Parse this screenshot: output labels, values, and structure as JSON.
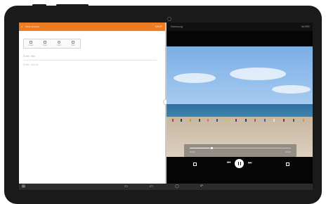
{
  "left_app": {
    "title": "New memo",
    "action": "SAVE",
    "toolbar": [
      {
        "label": "Image",
        "icon": "image-icon"
      },
      {
        "label": "Draw",
        "icon": "draw-icon"
      },
      {
        "label": "Voice",
        "icon": "microphone-icon"
      },
      {
        "label": "Task",
        "icon": "checkbox-icon"
      }
    ],
    "title_placeholder": "Enter title",
    "content_placeholder": "Enter memo"
  },
  "right_app": {
    "title": "Samsung",
    "action": "MORE",
    "player": {
      "progress": 0.22,
      "time_elapsed": "00:00",
      "time_total": "00:00"
    }
  },
  "colors": {
    "memo_header": "#f07c22",
    "video_bg": "#050505"
  }
}
